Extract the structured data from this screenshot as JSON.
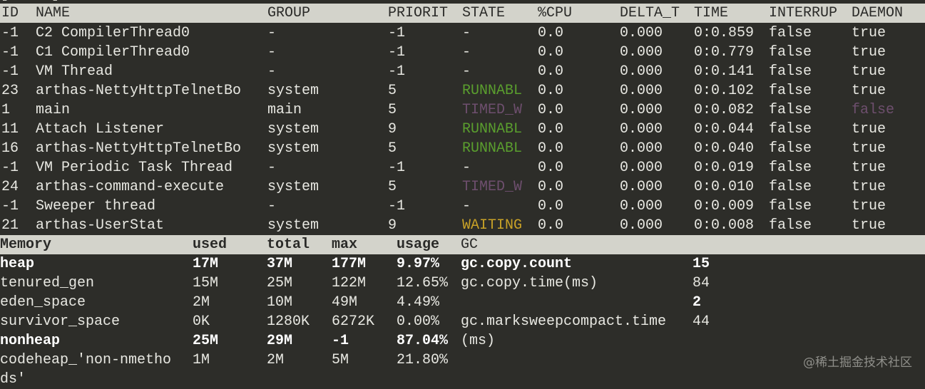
{
  "top_fragment": "[ ... ]",
  "thread_columns": [
    "ID",
    "NAME",
    "GROUP",
    "PRIORIT",
    "STATE",
    "%CPU",
    "DELTA_T",
    "TIME",
    "INTERRUP",
    "DAEMON"
  ],
  "threads": [
    {
      "id": "-1",
      "name": "C2 CompilerThread0",
      "group": "-",
      "priority": "-1",
      "state": "-",
      "cpu": "0.0",
      "delta_t": "0.000",
      "time": "0:0.859",
      "interrupted": "false",
      "daemon": "true"
    },
    {
      "id": "-1",
      "name": "C1 CompilerThread0",
      "group": "-",
      "priority": "-1",
      "state": "-",
      "cpu": "0.0",
      "delta_t": "0.000",
      "time": "0:0.779",
      "interrupted": "false",
      "daemon": "true"
    },
    {
      "id": "-1",
      "name": "VM Thread",
      "group": "-",
      "priority": "-1",
      "state": "-",
      "cpu": "0.0",
      "delta_t": "0.000",
      "time": "0:0.141",
      "interrupted": "false",
      "daemon": "true"
    },
    {
      "id": "23",
      "name": "arthas-NettyHttpTelnetBo",
      "group": "system",
      "priority": "5",
      "state": "RUNNABL",
      "cpu": "0.0",
      "delta_t": "0.000",
      "time": "0:0.102",
      "interrupted": "false",
      "daemon": "true"
    },
    {
      "id": "1",
      "name": "main",
      "group": "main",
      "priority": "5",
      "state": "TIMED_W",
      "cpu": "0.0",
      "delta_t": "0.000",
      "time": "0:0.082",
      "interrupted": "false",
      "daemon": "false"
    },
    {
      "id": "11",
      "name": "Attach Listener",
      "group": "system",
      "priority": "9",
      "state": "RUNNABL",
      "cpu": "0.0",
      "delta_t": "0.000",
      "time": "0:0.044",
      "interrupted": "false",
      "daemon": "true"
    },
    {
      "id": "16",
      "name": "arthas-NettyHttpTelnetBo",
      "group": "system",
      "priority": "5",
      "state": "RUNNABL",
      "cpu": "0.0",
      "delta_t": "0.000",
      "time": "0:0.040",
      "interrupted": "false",
      "daemon": "true"
    },
    {
      "id": "-1",
      "name": "VM Periodic Task Thread",
      "group": "-",
      "priority": "-1",
      "state": "-",
      "cpu": "0.0",
      "delta_t": "0.000",
      "time": "0:0.019",
      "interrupted": "false",
      "daemon": "true"
    },
    {
      "id": "24",
      "name": "arthas-command-execute",
      "group": "system",
      "priority": "5",
      "state": "TIMED_W",
      "cpu": "0.0",
      "delta_t": "0.000",
      "time": "0:0.010",
      "interrupted": "false",
      "daemon": "true"
    },
    {
      "id": "-1",
      "name": "Sweeper thread",
      "group": "-",
      "priority": "-1",
      "state": "-",
      "cpu": "0.0",
      "delta_t": "0.000",
      "time": "0:0.009",
      "interrupted": "false",
      "daemon": "true"
    },
    {
      "id": "21",
      "name": "arthas-UserStat",
      "group": "system",
      "priority": "9",
      "state": "WAITING",
      "cpu": "0.0",
      "delta_t": "0.000",
      "time": "0:0.008",
      "interrupted": "false",
      "daemon": "true"
    }
  ],
  "memory_columns": [
    "Memory",
    "used",
    "total",
    "max",
    "usage",
    "GC"
  ],
  "memory": [
    {
      "name": "heap",
      "used": "17M",
      "total": "37M",
      "max": "177M",
      "usage": "9.97%",
      "gc_name": "gc.copy.count",
      "gc_value": "15",
      "bold": true,
      "gc_bold": true
    },
    {
      "name": "tenured_gen",
      "used": "15M",
      "total": "25M",
      "max": "122M",
      "usage": "12.65%",
      "gc_name": "gc.copy.time(ms)",
      "gc_value": "84",
      "bold": false,
      "gc_bold": false
    },
    {
      "name": "eden_space",
      "used": "2M",
      "total": "10M",
      "max": "49M",
      "usage": "4.49%",
      "gc_name": "",
      "gc_value": "2",
      "bold": false,
      "gc_bold": true
    },
    {
      "name": "survivor_space",
      "used": "0K",
      "total": "1280K",
      "max": "6272K",
      "usage": "0.00%",
      "gc_name": "gc.marksweepcompact.time",
      "gc_value": "44",
      "bold": false,
      "gc_bold": false
    },
    {
      "name": "nonheap",
      "used": "25M",
      "total": "29M",
      "max": "-1",
      "usage": "87.04%",
      "gc_name": "(ms)",
      "gc_value": "",
      "bold": true,
      "gc_bold": false
    },
    {
      "name": "codeheap_'non-nmetho",
      "used": "1M",
      "total": "2M",
      "max": "5M",
      "usage": "21.80%",
      "gc_name": "",
      "gc_value": "",
      "bold": false,
      "gc_bold": false
    },
    {
      "name": "ds'",
      "used": "",
      "total": "",
      "max": "",
      "usage": "",
      "gc_name": "",
      "gc_value": "",
      "bold": false,
      "gc_bold": false
    }
  ],
  "colors": {
    "background": "#2d2d29",
    "header_bg": "#d3d3cb",
    "text": "#e8e8e2",
    "RUNNABL": "#5a9e2e",
    "TIMED_W": "#6e4f6e",
    "WAITING": "#c9a227",
    "daemon_false": "#6e4f6e"
  },
  "watermark": "@稀土掘金技术社区"
}
